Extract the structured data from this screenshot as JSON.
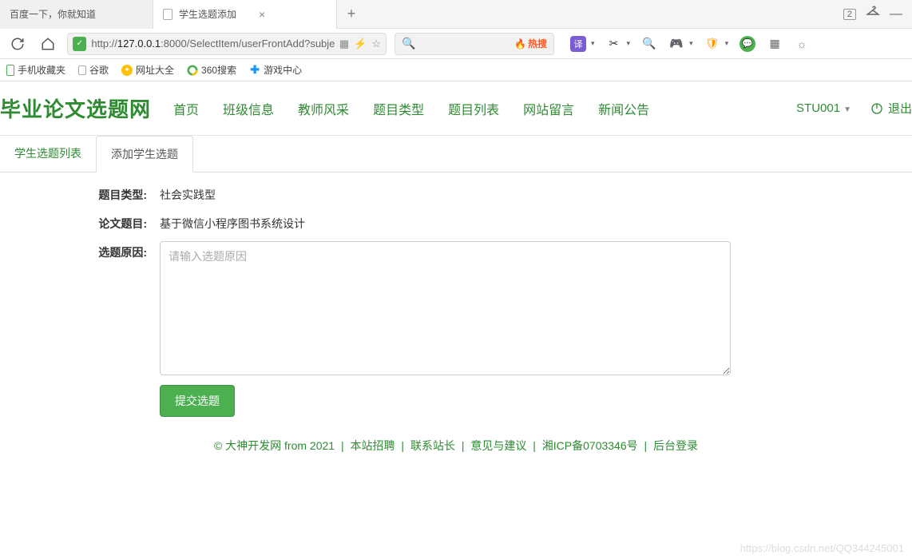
{
  "browser": {
    "tabs": [
      {
        "title": "百度一下，你就知道"
      },
      {
        "title": "学生选题添加"
      }
    ],
    "tab_count": "2",
    "url_prefix": "http://",
    "url_host": "127.0.0.1",
    "url_port": ":8000",
    "url_path": "/SelectItem/userFrontAdd?subject",
    "hot_label": "热搜",
    "translate_label": "译"
  },
  "bookmarks": [
    "手机收藏夹",
    "谷歌",
    "网址大全",
    "360搜索",
    "游戏中心"
  ],
  "site": {
    "logo": "毕业论文选题网",
    "nav": [
      "首页",
      "班级信息",
      "教师风采",
      "题目类型",
      "题目列表",
      "网站留言",
      "新闻公告"
    ],
    "user": "STU001",
    "logout": "退出"
  },
  "page_tabs": [
    "学生选题列表",
    "添加学生选题"
  ],
  "form": {
    "type_label": "题目类型:",
    "type_value": "社会实践型",
    "title_label": "论文题目:",
    "title_value": "基于微信小程序图书系统设计",
    "reason_label": "选题原因:",
    "reason_placeholder": "请输入选题原因",
    "submit": "提交选题"
  },
  "footer": {
    "copyright": "© 大神开发网 from 2021",
    "links": [
      "本站招聘",
      "联系站长",
      "意见与建议",
      "湘ICP备0703346号",
      "后台登录"
    ]
  },
  "watermark": "https://blog.csdn.net/QQ344245001"
}
